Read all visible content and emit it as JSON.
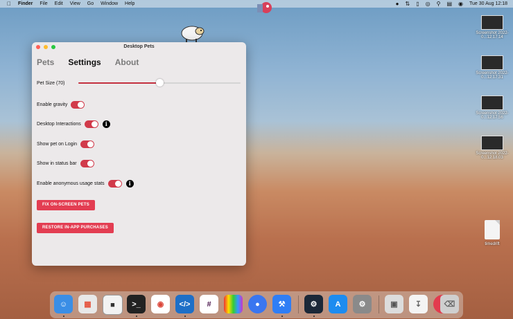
{
  "menubar": {
    "apple_icon": "apple-icon",
    "app_name": "Finder",
    "menus": [
      "File",
      "Edit",
      "View",
      "Go",
      "Window",
      "Help"
    ],
    "datetime": "Tue 30 Aug  12:18"
  },
  "desktop_icons": [
    {
      "label": "Screenshot 2022-0...12.17.14"
    },
    {
      "label": "Screenshot 2022-0...12.17.31"
    },
    {
      "label": "Screenshot 2022-0...12.17.56"
    },
    {
      "label": "Screenshot 2022-0...12.18.03"
    },
    {
      "label": "timedrift"
    }
  ],
  "window": {
    "title": "Desktop Pets",
    "tabs": [
      "Pets",
      "Settings",
      "About"
    ],
    "active_tab": "Settings",
    "pet_size_label": "Pet Size (70)",
    "pet_size_value": 0.5,
    "settings": [
      {
        "label": "Enable gravity",
        "on": true
      },
      {
        "label": "Desktop Interactions",
        "on": true,
        "info": true
      },
      {
        "label": "Show pet on Login",
        "on": true
      },
      {
        "label": "Show in status bar",
        "on": true
      },
      {
        "label": "Enable anonymous usage stats",
        "on": true,
        "info": true
      }
    ],
    "info_glyph": "i",
    "buttons": {
      "fix": "FIX ON-SCREEN PETS",
      "restore": "RESTORE IN-APP PURCHASES"
    },
    "accent_color": "#e33d52"
  },
  "dock": {
    "apps": [
      "Finder",
      "Launchpad",
      "Desktop Pets",
      "Terminal",
      "Chrome",
      "VS Code",
      "Slack",
      "TV Bars",
      "Signal",
      "Xcode",
      "Steam",
      "App Store",
      "System Preferences",
      "Preview",
      "Downloads",
      "Trash"
    ]
  }
}
